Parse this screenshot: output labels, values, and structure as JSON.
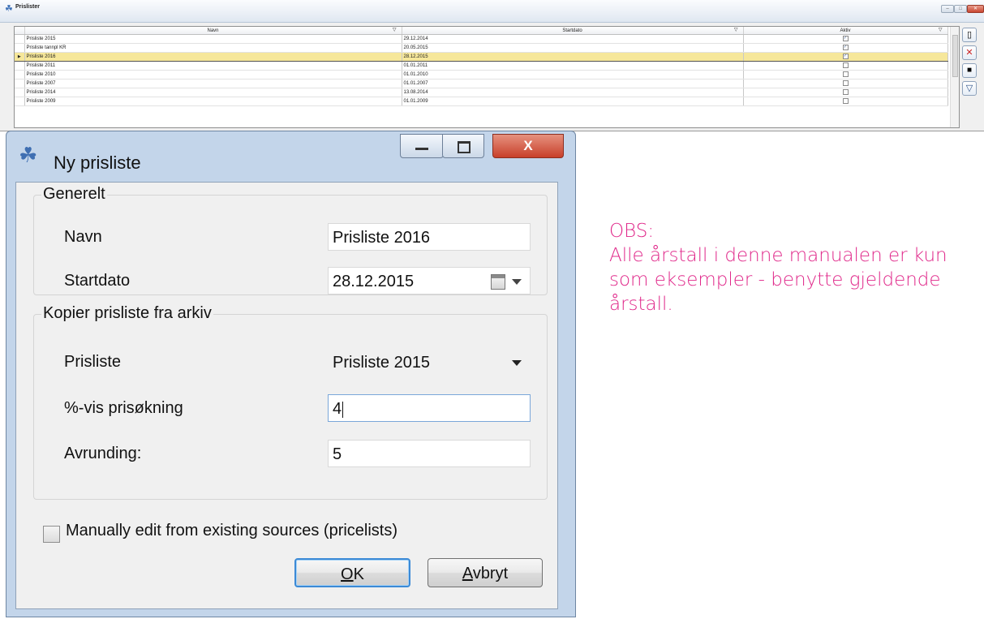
{
  "list_window": {
    "title": "Prislister",
    "columns": [
      {
        "label": "Navn"
      },
      {
        "label": "Startdato"
      },
      {
        "label": "Aktiv"
      }
    ],
    "rows": [
      {
        "name": "Prisliste 2015",
        "date": "29.12.2014",
        "active": true,
        "selected": false
      },
      {
        "name": "Prisliste tannpl KR",
        "date": "20.05.2015",
        "active": true,
        "selected": false
      },
      {
        "name": "Prisliste 2016",
        "date": "28.12.2015",
        "active": true,
        "selected": true
      },
      {
        "name": "Prisliste 2011",
        "date": "01.01.2011",
        "active": false,
        "selected": false
      },
      {
        "name": "Prisliste 2010",
        "date": "01.01.2010",
        "active": false,
        "selected": false
      },
      {
        "name": "Prisliste  2007",
        "date": "01.01.2007",
        "active": false,
        "selected": false
      },
      {
        "name": "Prisliste 2014",
        "date": "13.08.2014",
        "active": false,
        "selected": false
      },
      {
        "name": "Prisliste 2009",
        "date": "01.01.2009",
        "active": false,
        "selected": false
      }
    ],
    "side_buttons": [
      "new-icon",
      "delete-icon",
      "save-icon",
      "filter-icon"
    ]
  },
  "dialog": {
    "title": "Ny prisliste",
    "close_label": "X",
    "general": {
      "legend": "Generelt",
      "name_label": "Navn",
      "name_value": "Prisliste 2016",
      "start_label": "Startdato",
      "start_value": "28.12.2015"
    },
    "copy": {
      "legend": "Kopier prisliste fra arkiv",
      "pricelist_label": "Prisliste",
      "pricelist_value": "Prisliste 2015",
      "increase_label": "%-vis prisøkning",
      "increase_value": "4",
      "rounding_label": "Avrunding:",
      "rounding_value": "5"
    },
    "manual_edit": {
      "label": "Manually edit from existing sources (pricelists)",
      "checked": false
    },
    "ok": {
      "mnemonic": "O",
      "rest": "K"
    },
    "cancel": {
      "mnemonic": "A",
      "rest": "vbryt"
    }
  },
  "note": {
    "heading": "OBS:",
    "line1": "Alle årstall i denne manualen er kun",
    "line2": "som eksempler - benytte gjeldende",
    "line3": "årstall.",
    "color": "#e0288a"
  }
}
